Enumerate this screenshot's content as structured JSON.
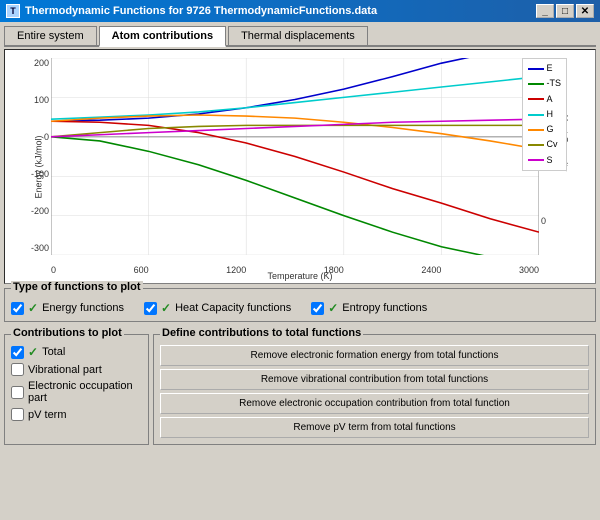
{
  "window": {
    "title": "Thermodynamic Functions for 9726 ThermodynamicFunctions.data",
    "minimize_label": "_",
    "restore_label": "□",
    "close_label": "✕"
  },
  "tabs": [
    {
      "id": "entire-system",
      "label": "Entire system",
      "active": false
    },
    {
      "id": "atom-contributions",
      "label": "Atom contributions",
      "active": true
    },
    {
      "id": "thermal-displacements",
      "label": "Thermal displacements",
      "active": false
    }
  ],
  "chart": {
    "y_label_left": "Energy (kJ/mol)",
    "y_label_right": "Heat Capacity",
    "x_label": "Temperature (K)",
    "y_ticks_left": [
      "200",
      "100",
      "0",
      "-100",
      "-200",
      "-300"
    ],
    "y_ticks_right": [
      "60",
      "30",
      "0"
    ],
    "x_ticks": [
      "0",
      "600",
      "1200",
      "1800",
      "2400",
      "3000"
    ],
    "legend": [
      {
        "label": "E",
        "color": "#0000cc"
      },
      {
        "label": "-TS",
        "color": "#008800"
      },
      {
        "label": "A",
        "color": "#cc0000"
      },
      {
        "label": "H",
        "color": "#00aaaa"
      },
      {
        "label": "G",
        "color": "#ff8800"
      },
      {
        "label": "Cv",
        "color": "#888800"
      },
      {
        "label": "S",
        "color": "#cc00cc"
      }
    ]
  },
  "functions_group": {
    "title": "Type of functions to plot",
    "items": [
      {
        "label": "Energy functions",
        "checked": true
      },
      {
        "label": "Heat Capacity functions",
        "checked": true
      },
      {
        "label": "Entropy functions",
        "checked": true
      }
    ]
  },
  "contributions_group": {
    "title": "Contributions to plot",
    "items": [
      {
        "label": "Total",
        "checked": true
      },
      {
        "label": "Vibrational part",
        "checked": false
      },
      {
        "label": "Electronic occupation part",
        "checked": false
      },
      {
        "label": "pV term",
        "checked": false
      }
    ]
  },
  "define_group": {
    "title": "Define contributions to total functions",
    "buttons": [
      {
        "label": "Remove electronic formation energy from total functions"
      },
      {
        "label": "Remove vibrational contribution from total functions"
      },
      {
        "label": "Remove electronic occupation contribution from total function"
      },
      {
        "label": "Remove pV term from total functions"
      }
    ]
  }
}
